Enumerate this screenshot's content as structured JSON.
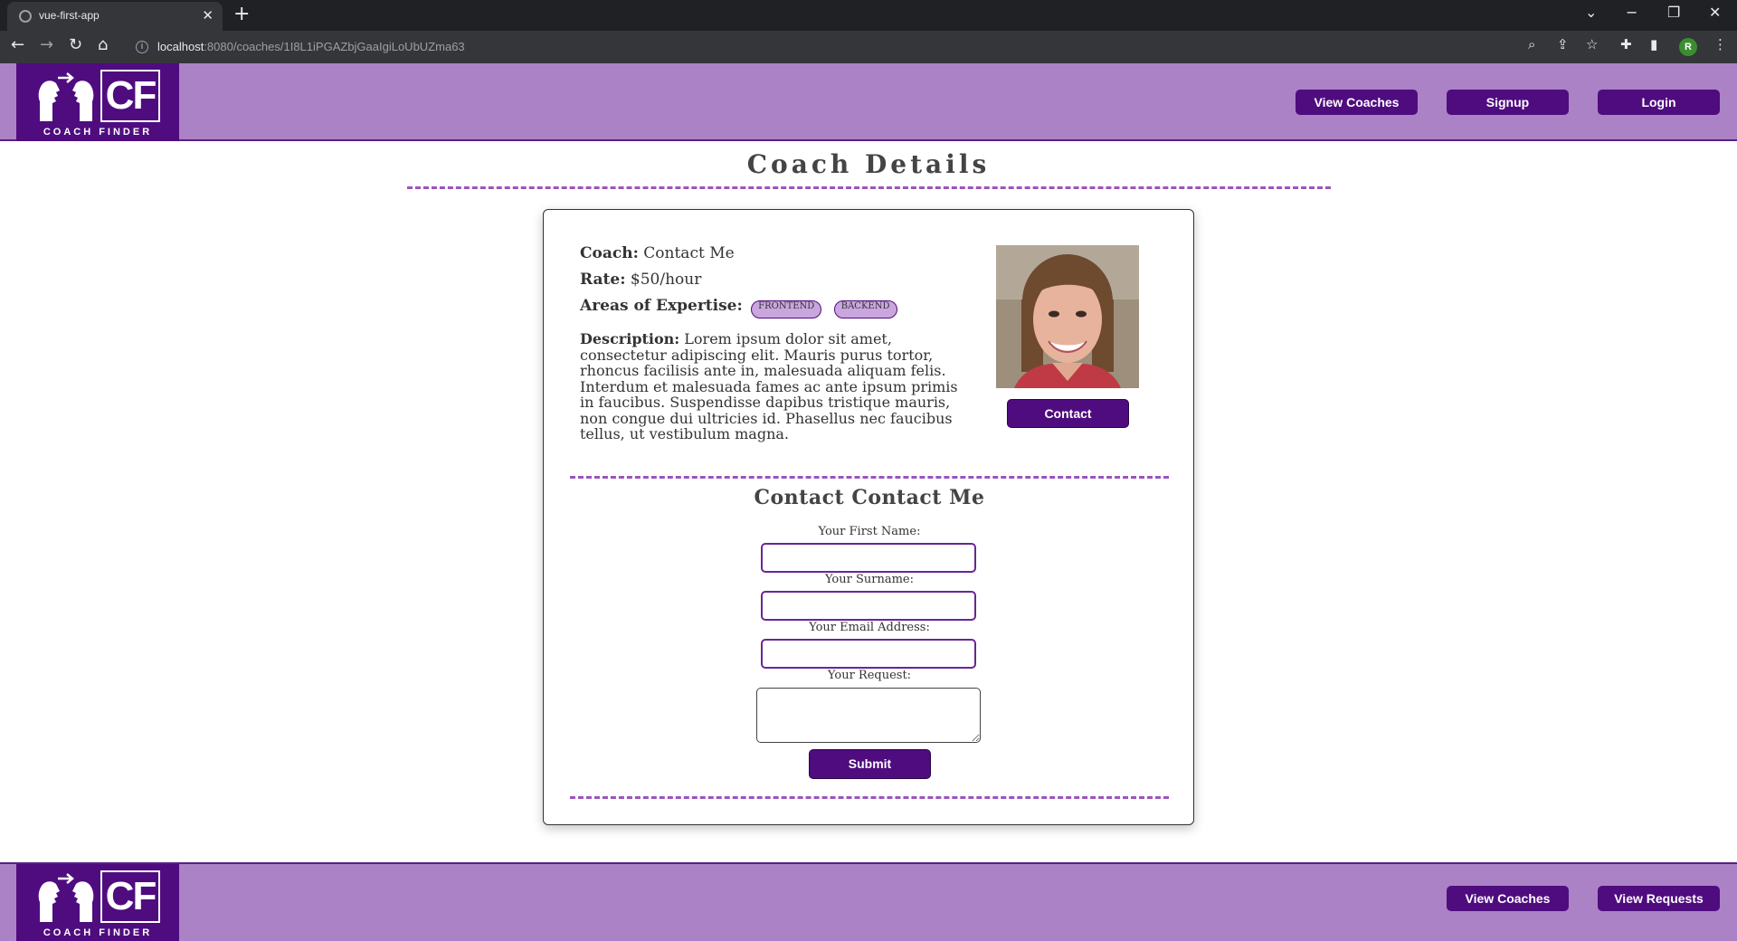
{
  "browser": {
    "tab_title": "vue-first-app",
    "tab_close": "✕",
    "new_tab": "+",
    "url_host": "localhost",
    "url_path": ":8080/coaches/1I8L1iPGAZbjGaaIgiLoUbUZma63",
    "profile_initial": "R"
  },
  "header": {
    "logo_text": "COACH FINDER",
    "logo_letters": "CF",
    "nav": {
      "view_coaches": "View Coaches",
      "signup": "Signup",
      "login": "Login"
    }
  },
  "main": {
    "page_title": "Coach Details",
    "coach": {
      "coach_label": "Coach:",
      "coach_name": "Contact Me",
      "rate_label": "Rate:",
      "rate_value": "$50/hour",
      "areas_label": "Areas of Expertise:",
      "areas": [
        "FRONTEND",
        "BACKEND"
      ],
      "description_label": "Description:",
      "description": "Lorem ipsum dolor sit amet, consectetur adipiscing elit. Mauris purus tortor, rhoncus facilisis ante in, malesuada aliquam felis. Interdum et malesuada fames ac ante ipsum primis in faucibus. Suspendisse dapibus tristique mauris, non congue dui ultricies id. Phasellus nec faucibus tellus, ut vestibulum magna.",
      "contact_button": "Contact"
    },
    "form": {
      "title": "Contact Contact Me",
      "first_name_label": "Your First Name:",
      "first_name_value": "",
      "surname_label": "Your Surname:",
      "surname_value": "",
      "email_label": "Your Email Address:",
      "email_value": "",
      "request_label": "Your Request:",
      "request_value": "",
      "submit": "Submit"
    }
  },
  "footer": {
    "logo_text": "COACH FINDER",
    "logo_letters": "CF",
    "nav": {
      "view_coaches": "View Coaches",
      "view_requests": "View Requests"
    }
  },
  "colors": {
    "brand_dark": "#4f0c7f",
    "brand_light": "#ab82c5",
    "rule": "#9b54c0",
    "badge": "#c9a6de"
  }
}
